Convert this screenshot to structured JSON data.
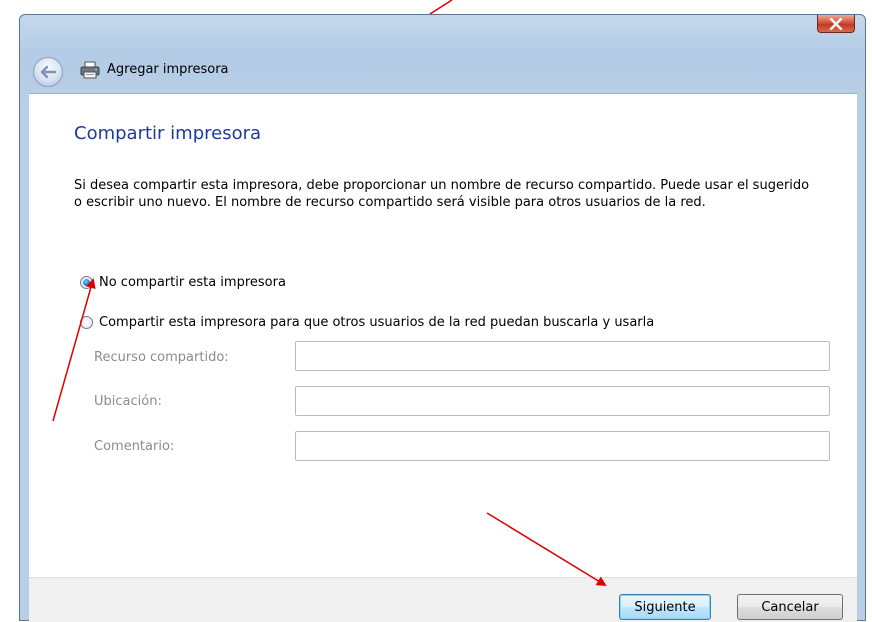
{
  "window": {
    "title": "Agregar impresora",
    "icons": {
      "close": "close-icon",
      "back": "back-arrow-icon",
      "title": "printer-icon"
    }
  },
  "page": {
    "heading": "Compartir impresora",
    "description": "Si desea compartir esta impresora, debe proporcionar un nombre de recurso compartido. Puede usar el sugerido o escribir uno nuevo. El nombre de recurso compartido será visible para otros usuarios de la red."
  },
  "options": {
    "no_share": {
      "label": "No compartir esta impresora",
      "selected": true
    },
    "share": {
      "label": "Compartir esta impresora para que otros usuarios de la red puedan buscarla y usarla",
      "selected": false
    }
  },
  "fields": {
    "share_name": {
      "label": "Recurso compartido:",
      "value": ""
    },
    "location": {
      "label": "Ubicación:",
      "value": ""
    },
    "comment": {
      "label": "Comentario:",
      "value": ""
    }
  },
  "buttons": {
    "next": "Siguiente",
    "cancel": "Cancelar"
  },
  "colors": {
    "heading": "#1e3a9b",
    "annotation_arrow": "#e00000",
    "disabled_text": "#8c8c8c"
  }
}
